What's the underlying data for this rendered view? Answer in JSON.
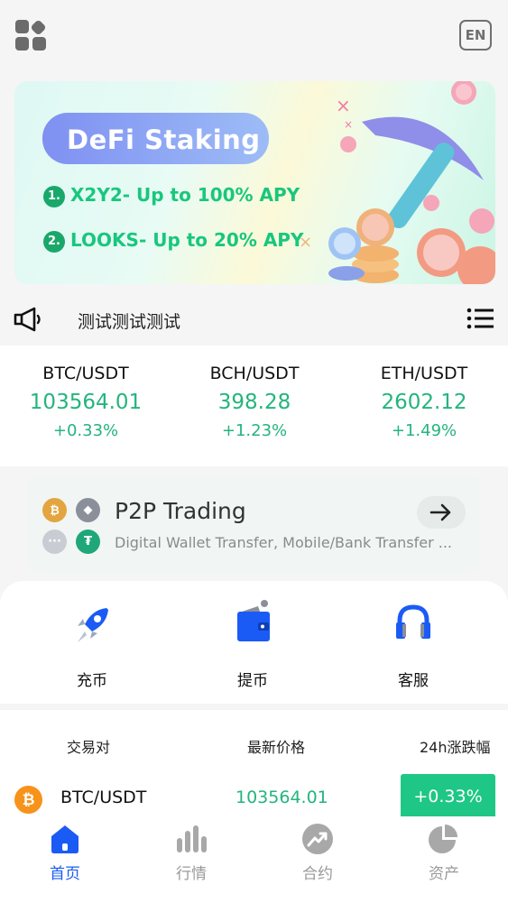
{
  "header": {
    "lang_label": "EN"
  },
  "banner": {
    "title": "DeFi Staking",
    "lines": [
      {
        "num": "1.",
        "text": "X2Y2- Up to 100% APY"
      },
      {
        "num": "2.",
        "text": "LOOKS- Up to 20% APY"
      }
    ]
  },
  "notice": {
    "text": "测试测试测试"
  },
  "tickers": [
    {
      "pair": "BTC/USDT",
      "price": "103564.01",
      "change": "+0.33%"
    },
    {
      "pair": "BCH/USDT",
      "price": "398.28",
      "change": "+1.23%"
    },
    {
      "pair": "ETH/USDT",
      "price": "2602.12",
      "change": "+1.49%"
    }
  ],
  "p2p": {
    "title": "P2P Trading",
    "subtitle": "Digital Wallet Transfer, Mobile/Bank Transfer ..."
  },
  "actions": [
    {
      "label": "充币",
      "icon": "rocket-icon"
    },
    {
      "label": "提币",
      "icon": "wallet-icon"
    },
    {
      "label": "客服",
      "icon": "headset-icon"
    }
  ],
  "market": {
    "headers": [
      "交易对",
      "最新价格",
      "24h涨跌幅"
    ],
    "rows": [
      {
        "pair": "BTC/USDT",
        "price": "103564.01",
        "change": "+0.33%"
      }
    ]
  },
  "tabbar": [
    {
      "label": "首页",
      "icon": "home-icon",
      "active": true
    },
    {
      "label": "行情",
      "icon": "chart-bars-icon",
      "active": false
    },
    {
      "label": "合约",
      "icon": "trend-icon",
      "active": false
    },
    {
      "label": "资产",
      "icon": "pie-icon",
      "active": false
    }
  ],
  "colors": {
    "up_green": "#24b47e",
    "accent_blue": "#1b5bf5",
    "badge_green": "#1ec785"
  }
}
